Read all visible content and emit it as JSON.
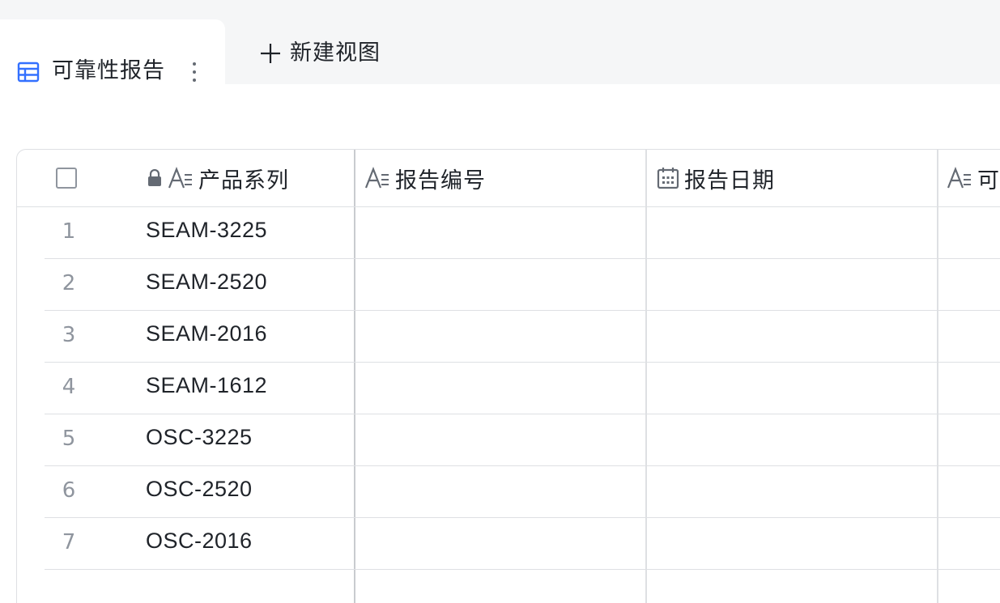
{
  "tabs": {
    "active_label": "可靠性报告",
    "new_view_label": "新建视图"
  },
  "table": {
    "columns": [
      {
        "label": "产品系列",
        "icon": "text-field-icon",
        "locked": true
      },
      {
        "label": "报告编号",
        "icon": "text-field-icon"
      },
      {
        "label": "报告日期",
        "icon": "date-field-icon"
      },
      {
        "label": "可",
        "icon": "text-field-icon"
      }
    ],
    "rows": [
      {
        "num": "1",
        "product": "SEAM-3225"
      },
      {
        "num": "2",
        "product": "SEAM-2520"
      },
      {
        "num": "3",
        "product": "SEAM-2016"
      },
      {
        "num": "4",
        "product": "SEAM-1612"
      },
      {
        "num": "5",
        "product": "OSC-3225"
      },
      {
        "num": "6",
        "product": "OSC-2520"
      },
      {
        "num": "7",
        "product": "OSC-2016"
      }
    ]
  },
  "colors": {
    "accent": "#3370ff",
    "border": "#dee0e3",
    "tabbar_bg": "#f5f6f7",
    "muted_text": "#8f959e"
  }
}
